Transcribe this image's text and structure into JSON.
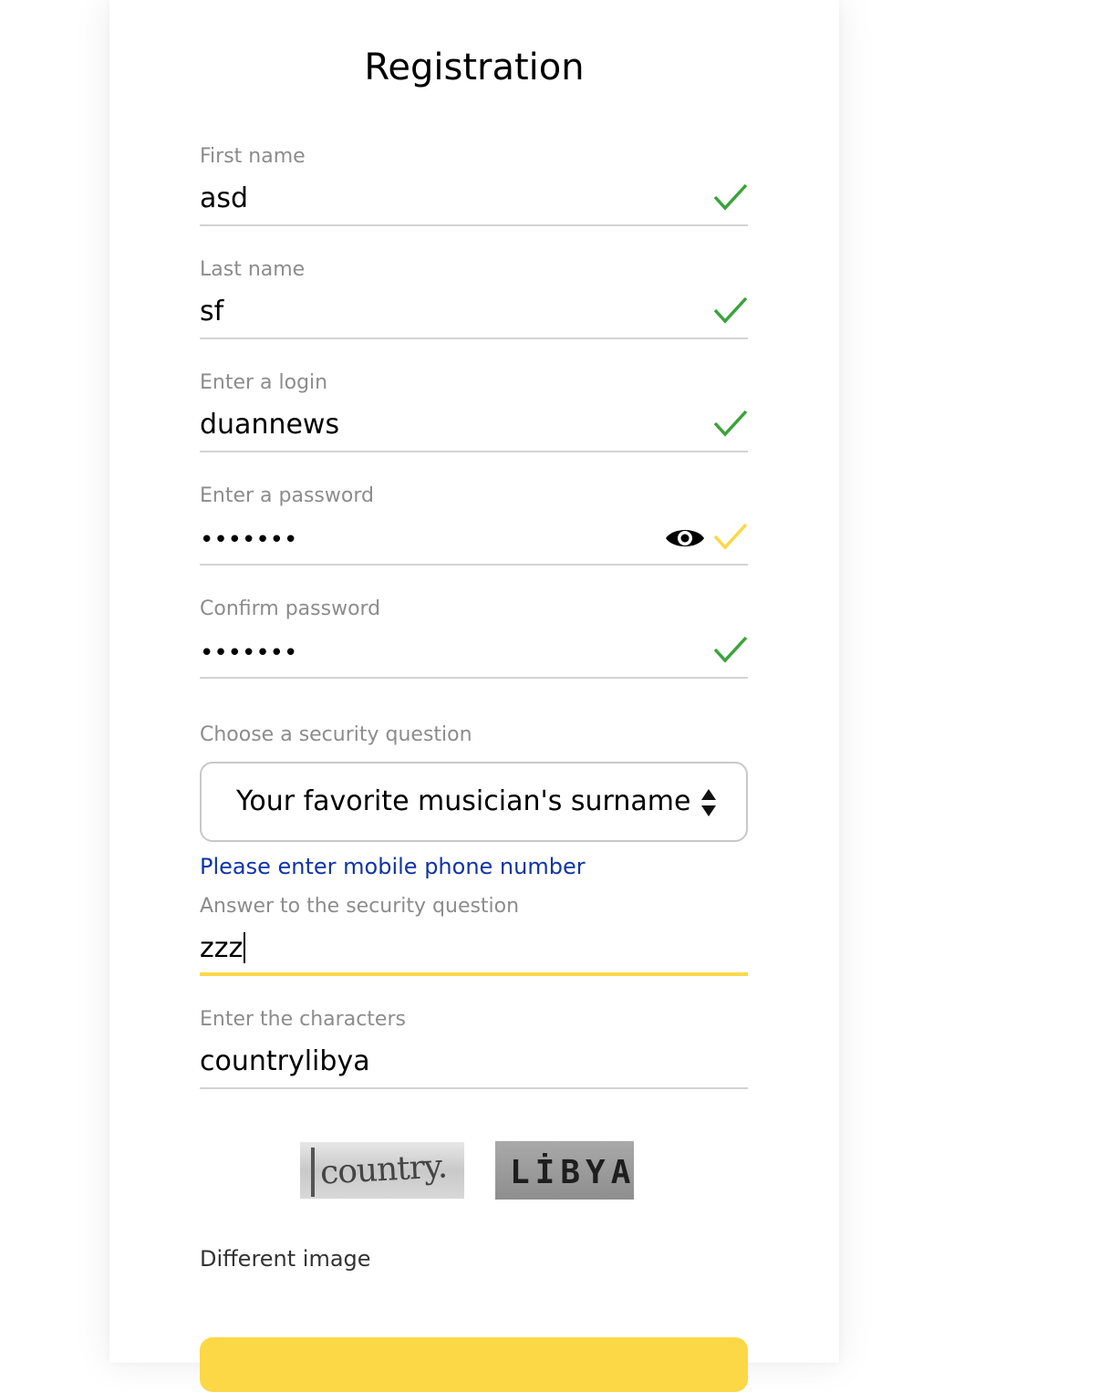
{
  "title": "Registration",
  "fields": {
    "first_name": {
      "label": "First name",
      "value": "asd"
    },
    "last_name": {
      "label": "Last name",
      "value": "sf"
    },
    "login": {
      "label": "Enter a login",
      "value": "duannews"
    },
    "password": {
      "label": "Enter a password",
      "value": "•••••••"
    },
    "confirm": {
      "label": "Confirm password",
      "value": "•••••••"
    },
    "security_question": {
      "label": "Choose a security question",
      "value": "Your favorite musician's surname"
    },
    "phone_link": "Please enter mobile phone number",
    "answer": {
      "label": "Answer to the security question",
      "value": "zzz"
    },
    "captcha": {
      "label": "Enter the characters",
      "value": "countrylibya"
    }
  },
  "captcha_images": {
    "word1": "country.",
    "word2": "LİBYA"
  },
  "different_image_link": "Different image",
  "colors": {
    "valid": "#3aa33a",
    "warning": "#fcd847",
    "link": "#0f34a8",
    "accent": "#fcd847"
  }
}
